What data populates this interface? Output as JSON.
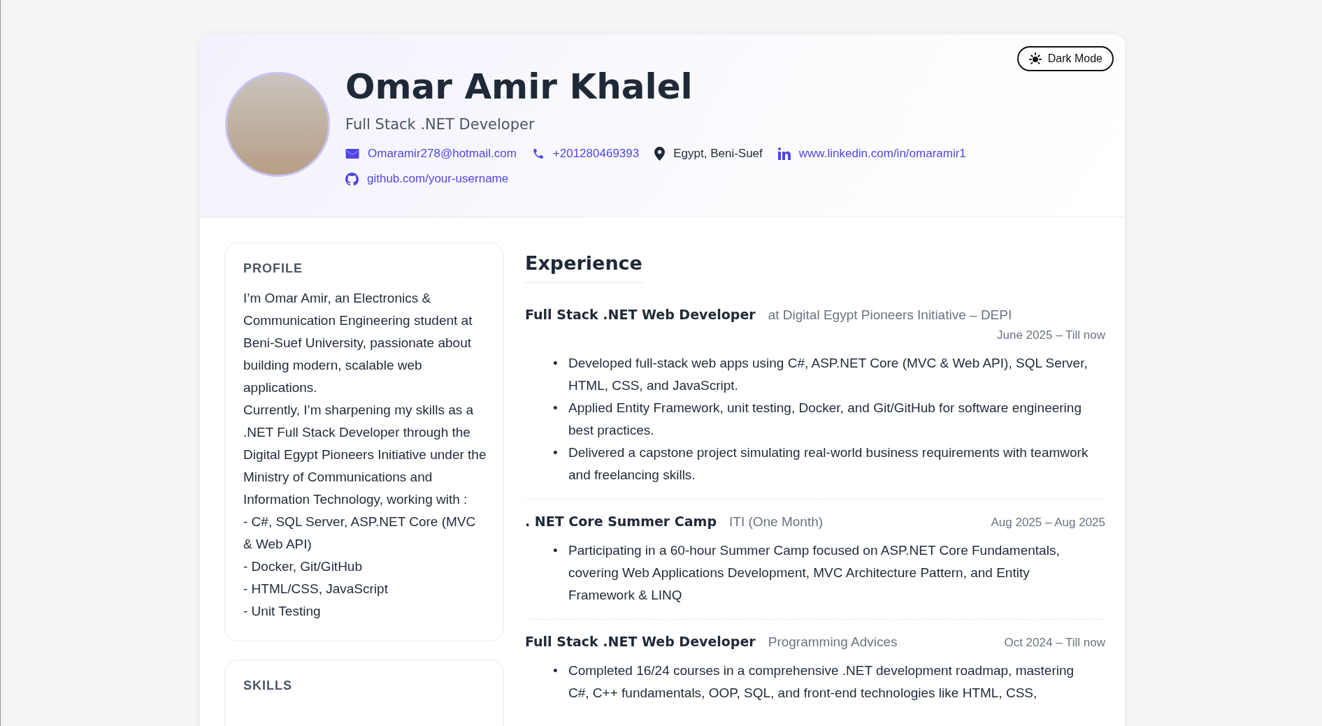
{
  "header": {
    "name": "Omar Amir Khalel",
    "title": "Full Stack .NET Developer",
    "theme_button": "Dark Mode",
    "contacts": [
      {
        "kind": "email",
        "text": "Omaramir278@hotmail.com"
      },
      {
        "kind": "phone",
        "text": "+201280469393"
      },
      {
        "kind": "location",
        "text": "Egypt, Beni-Suef"
      },
      {
        "kind": "linkedin",
        "text": "www.linkedin.com/in/omaramir1"
      },
      {
        "kind": "github",
        "text": "github.com/your-username"
      }
    ]
  },
  "sidebar": [
    {
      "heading": "PROFILE",
      "lines": [
        "I’m Omar Amir, an Electronics & Communication Engineering student at Beni-Suef University, passionate about building modern, scalable web applications.",
        "Currently, I’m sharpening my skills as a .NET Full Stack Developer through the Digital Egypt Pioneers Initiative under the Ministry of Communications and Information Technology, working with :",
        "- C#, SQL Server, ASP.NET Core (MVC & Web API)",
        "- Docker, Git/GitHub",
        "- HTML/CSS, JavaScript",
        "- Unit Testing"
      ]
    },
    {
      "heading": "SKILLS"
    }
  ],
  "experience": {
    "heading": "Experience",
    "items": [
      {
        "role": "Full Stack .NET Web Developer",
        "org": "at Digital Egypt Pioneers Initiative – DEPI",
        "date": "June 2025 – Till now",
        "bullets": [
          {
            "marker": "•",
            "text": "Developed full-stack web apps using C#, ASP.NET Core (MVC & Web API), SQL Server, HTML, CSS, and JavaScript."
          },
          {
            "marker": "•",
            "text": "Applied Entity Framework, unit testing, Docker, and Git/GitHub for software engineering best practices."
          },
          {
            "marker": "•",
            "text": "Delivered a capstone project simulating real-world business requirements with teamwork and freelancing skills."
          }
        ]
      },
      {
        "role": ". NET Core Summer Camp",
        "org": "ITI (One Month)",
        "date": "Aug 2025 – Aug 2025",
        "bullets": [
          {
            "marker": "•",
            "text": "Participating in a 60-hour Summer Camp focused on ASP.NET Core Fundamentals, covering Web Applications Development, MVC Architecture Pattern, and Entity Framework & LINQ"
          }
        ]
      },
      {
        "role": "Full Stack .NET Web Developer",
        "org": "Programming Advices",
        "date": "Oct 2024 – Till now",
        "bullets": [
          {
            "marker": "•",
            "text": "Completed 16/24 courses in a comprehensive .NET development roadmap, mastering C#, C++ fundamentals, OOP, SQL, and front-end technologies like HTML, CSS,"
          }
        ]
      }
    ]
  }
}
